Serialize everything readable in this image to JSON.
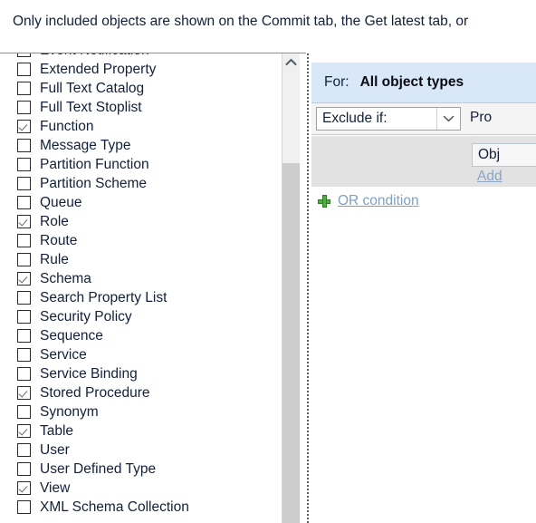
{
  "banner": {
    "message": "Only included objects are shown on the Commit tab, the Get latest tab, or"
  },
  "object_list": {
    "scrollbar": {
      "up_arrow_icon": "chevron-up-icon"
    },
    "items": [
      {
        "label": "Event Notification",
        "checked": false
      },
      {
        "label": "Extended Property",
        "checked": false
      },
      {
        "label": "Full Text Catalog",
        "checked": false
      },
      {
        "label": "Full Text Stoplist",
        "checked": false
      },
      {
        "label": "Function",
        "checked": true
      },
      {
        "label": "Message Type",
        "checked": false
      },
      {
        "label": "Partition Function",
        "checked": false
      },
      {
        "label": "Partition Scheme",
        "checked": false
      },
      {
        "label": "Queue",
        "checked": false
      },
      {
        "label": "Role",
        "checked": true
      },
      {
        "label": "Route",
        "checked": false
      },
      {
        "label": "Rule",
        "checked": false
      },
      {
        "label": "Schema",
        "checked": true
      },
      {
        "label": "Search Property List",
        "checked": false
      },
      {
        "label": "Security Policy",
        "checked": false
      },
      {
        "label": "Sequence",
        "checked": false
      },
      {
        "label": "Service",
        "checked": false
      },
      {
        "label": "Service Binding",
        "checked": false
      },
      {
        "label": "Stored Procedure",
        "checked": true
      },
      {
        "label": "Synonym",
        "checked": false
      },
      {
        "label": "Table",
        "checked": true
      },
      {
        "label": "User",
        "checked": false
      },
      {
        "label": "User Defined Type",
        "checked": false
      },
      {
        "label": "View",
        "checked": true
      },
      {
        "label": "XML Schema Collection",
        "checked": false
      }
    ]
  },
  "filter_panel": {
    "for_label": "For:",
    "for_value": "All object types",
    "exclude_combo": {
      "value": "Exclude if:",
      "arrow_icon": "chevron-down-icon"
    },
    "property_column_header": "Pro",
    "object_value": "Obj",
    "add_link": "Add",
    "or_condition": {
      "plus_icon": "plus-icon",
      "label": "OR condition"
    }
  }
}
